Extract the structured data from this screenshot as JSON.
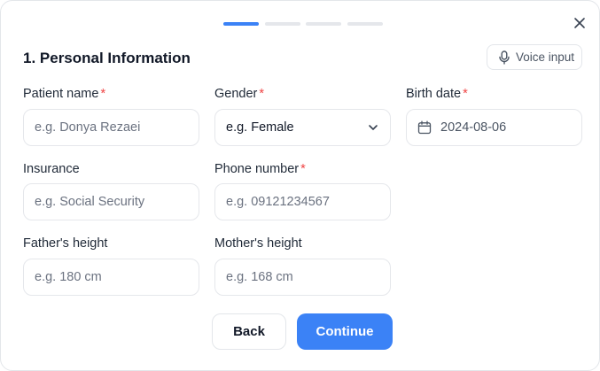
{
  "stepper": {
    "total_steps": 4,
    "current_step": 1
  },
  "close": {
    "icon": "close-icon"
  },
  "section": {
    "title": "1. Personal Information"
  },
  "voice": {
    "label": "Voice input",
    "icon": "microphone-icon"
  },
  "fields": {
    "patient_name": {
      "label": "Patient name",
      "required": "*",
      "placeholder": "e.g. Donya Rezaei"
    },
    "gender": {
      "label": "Gender",
      "required": "*",
      "value": "e.g. Female",
      "icon": "chevron-down-icon"
    },
    "birth_date": {
      "label": "Birth date",
      "required": "*",
      "value": "2024-08-06",
      "icon": "calendar-icon"
    },
    "insurance": {
      "label": "Insurance",
      "placeholder": "e.g. Social Security"
    },
    "phone": {
      "label": "Phone number",
      "required": "*",
      "placeholder": "e.g. 09121234567"
    },
    "father_height": {
      "label": "Father's height",
      "placeholder": "e.g. 180 cm"
    },
    "mother_height": {
      "label": "Mother's height",
      "placeholder": "e.g. 168 cm"
    }
  },
  "actions": {
    "back_label": "Back",
    "continue_label": "Continue"
  },
  "colors": {
    "accent": "#3b82f6",
    "required": "#ef4444"
  }
}
